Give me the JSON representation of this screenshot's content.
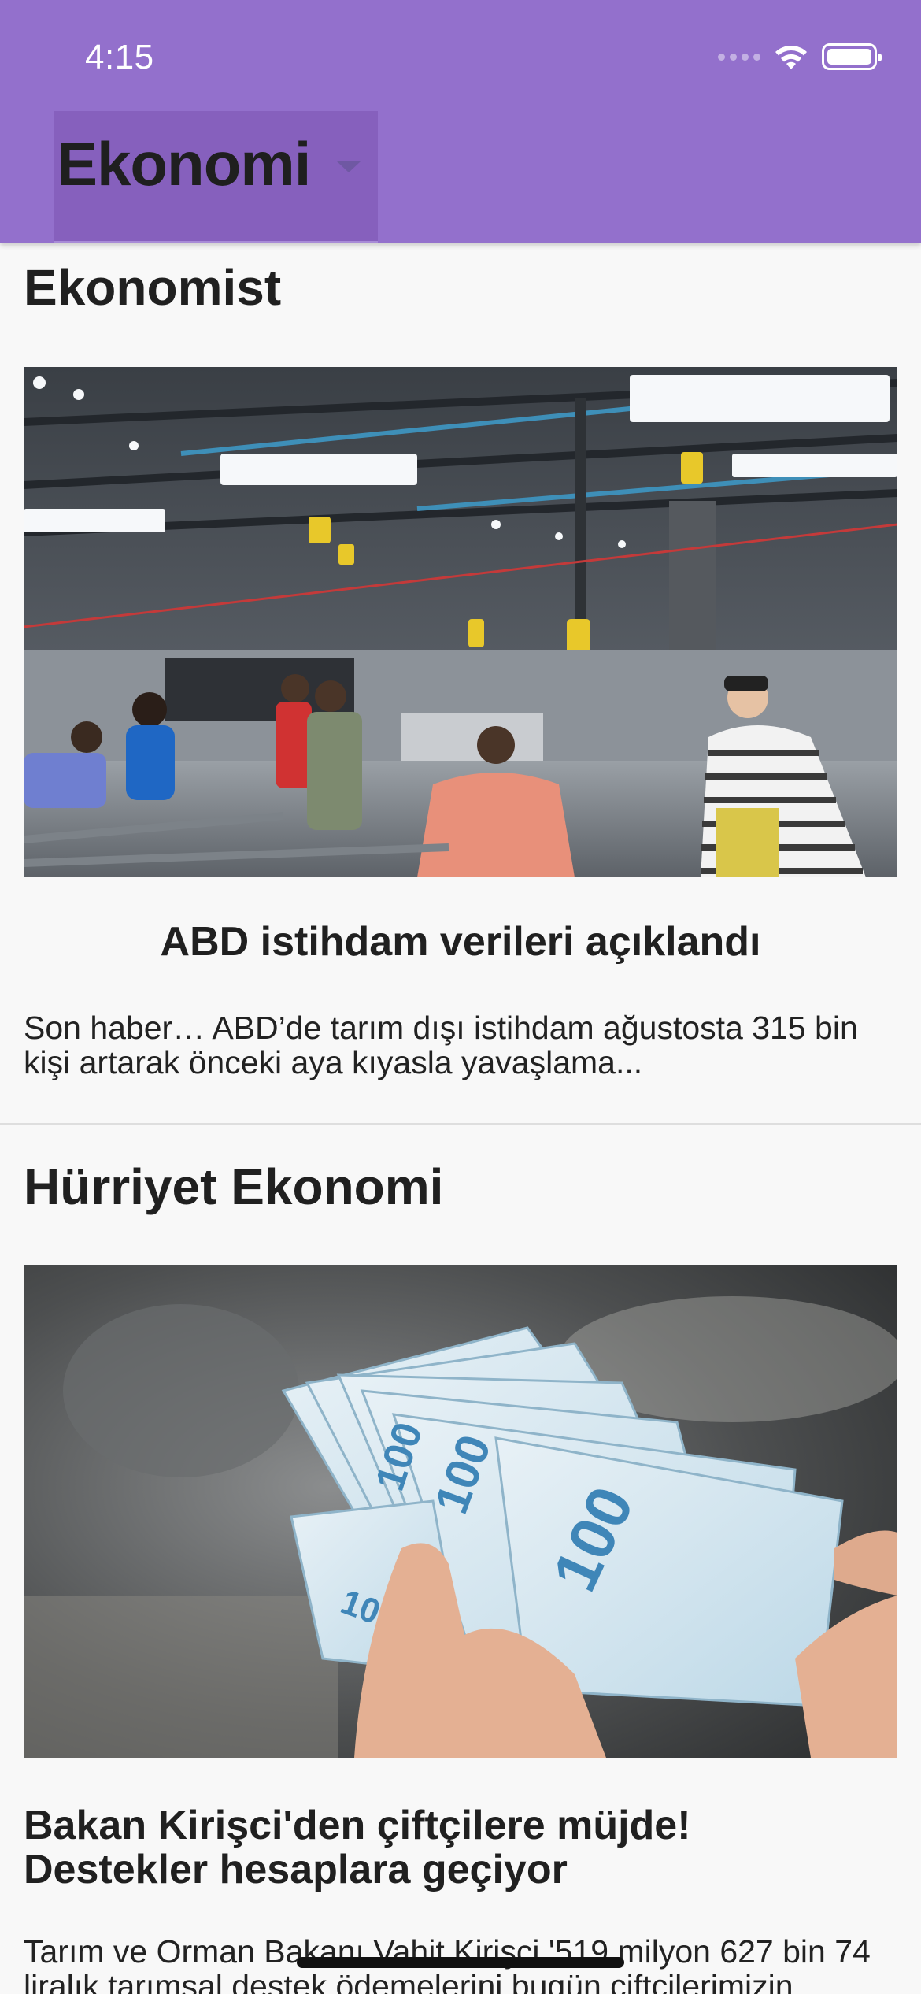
{
  "status_bar": {
    "time": "4:15"
  },
  "header": {
    "category": "Ekonomi"
  },
  "feed": [
    {
      "source": "Ekonomist",
      "title": "ABD istihdam verileri açıklandı",
      "summary_line1": "Son haber… ABD’de tarım dışı istihdam ağustosta 315 bin",
      "summary_line2": "kişi artarak önceki aya kıyasla yavaşlama..."
    },
    {
      "source": "Hürriyet Ekonomi",
      "title_line1": "Bakan Kirişci'den çiftçilere müjde!",
      "title_line2": "Destekler hesaplara geçiyor",
      "summary_line1": "Tarım ve Orman Bakanı Vahit Kirişci '519 milyon 627 bin 74",
      "summary_line2": "liralık tarımsal destek ödemelerini bugün çiftçilerimizin"
    }
  ]
}
